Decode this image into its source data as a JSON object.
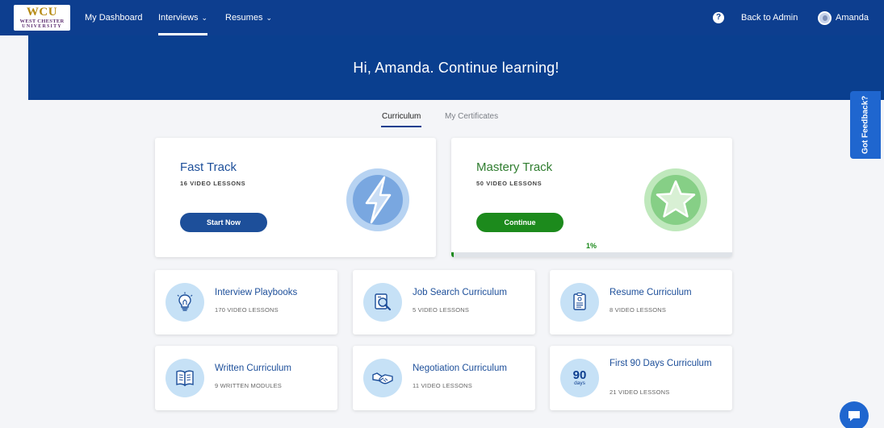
{
  "nav": {
    "logo": {
      "line1": "WCU",
      "line2": "WEST CHESTER",
      "line3": "UNIVERSITY"
    },
    "dashboard": "My Dashboard",
    "interviews": "Interviews",
    "resumes": "Resumes",
    "help": "?",
    "back_to_admin": "Back to Admin",
    "user_name": "Amanda"
  },
  "hero": {
    "greeting": "Hi, Amanda. Continue learning!"
  },
  "tabs": {
    "curriculum": "Curriculum",
    "certificates": "My Certificates"
  },
  "feedback": "Got Feedback?",
  "tracks": {
    "fast": {
      "title": "Fast Track",
      "subtitle": "16 VIDEO LESSONS",
      "button": "Start Now"
    },
    "mastery": {
      "title": "Mastery Track",
      "subtitle": "50 VIDEO LESSONS",
      "button": "Continue",
      "progress": "1%",
      "progress_value": 0.01
    }
  },
  "cards": [
    {
      "title": "Interview Playbooks",
      "subtitle": "170 VIDEO LESSONS",
      "icon": "lightbulb-icon"
    },
    {
      "title": "Job Search Curriculum",
      "subtitle": "5 VIDEO LESSONS",
      "icon": "magnifier-icon"
    },
    {
      "title": "Resume Curriculum",
      "subtitle": "8 VIDEO LESSONS",
      "icon": "document-icon"
    },
    {
      "title": "Written Curriculum",
      "subtitle": "9 WRITTEN MODULES",
      "icon": "book-icon"
    },
    {
      "title": "Negotiation Curriculum",
      "subtitle": "11 VIDEO LESSONS",
      "icon": "handshake-icon"
    },
    {
      "title": "First 90 Days Curriculum",
      "subtitle": "21 VIDEO LESSONS",
      "icon_number": "90",
      "icon_unit": "days"
    }
  ],
  "colors": {
    "nav": "#0d3e8f",
    "fast": "#1d4f9a",
    "mastery": "#1c8a1c",
    "feedback": "#1f66cf"
  }
}
